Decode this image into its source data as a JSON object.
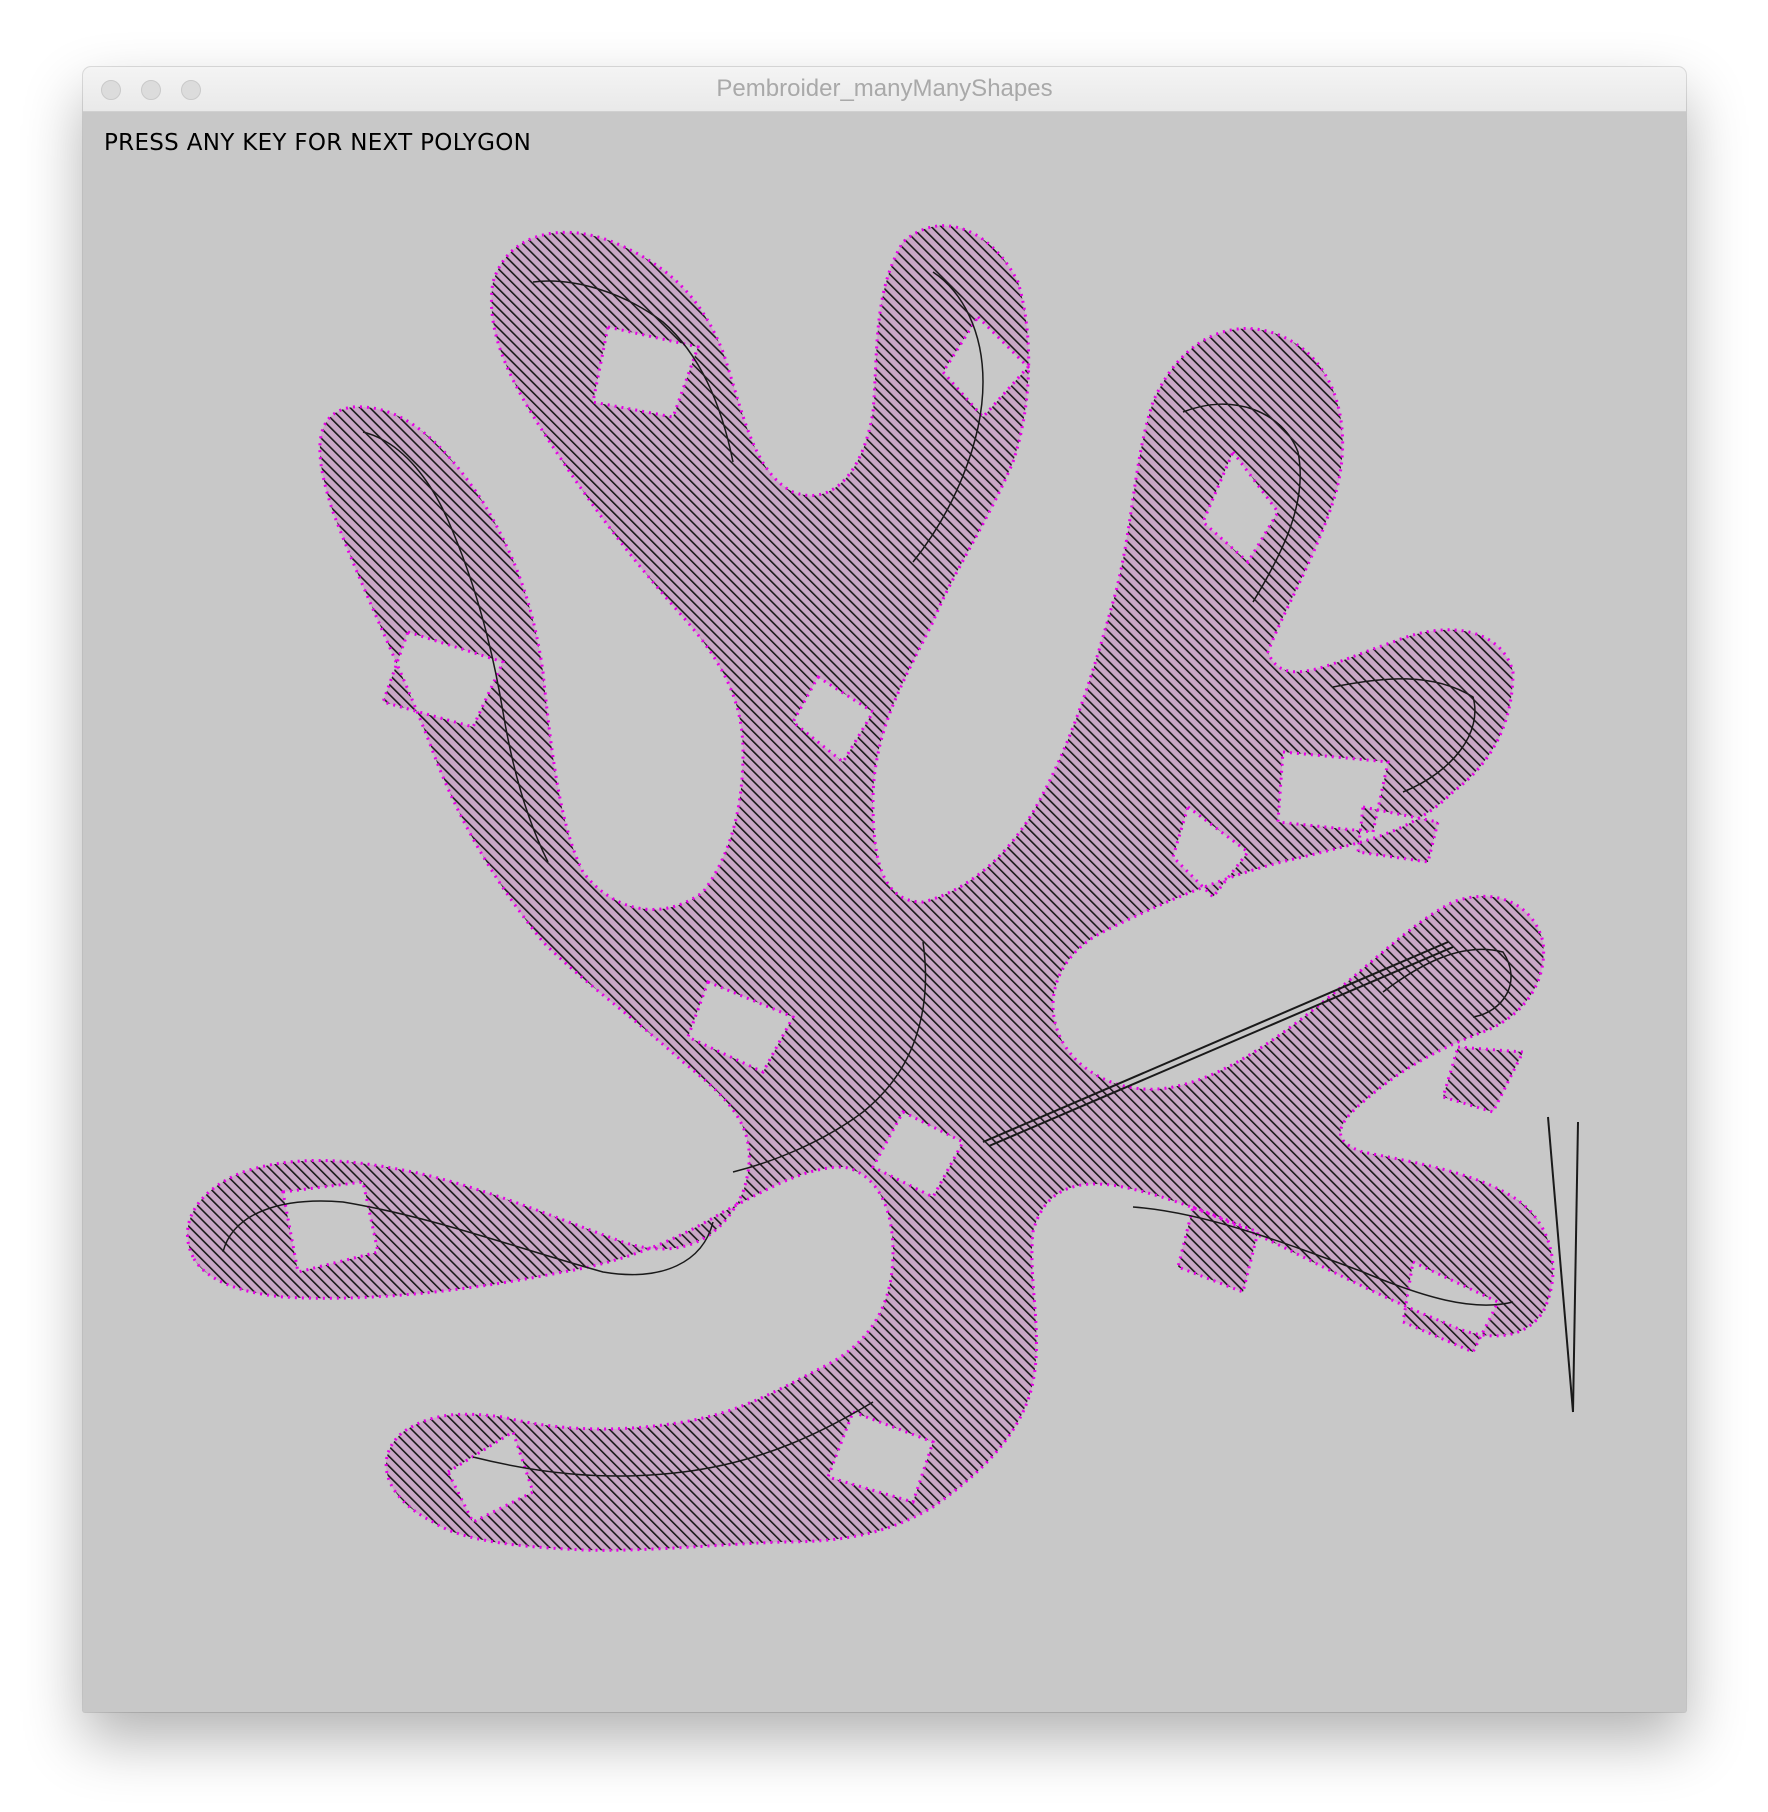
{
  "window": {
    "title": "Pembroider_manyManyShapes"
  },
  "canvas": {
    "prompt": "PRESS ANY KEY FOR NEXT POLYGON",
    "colors": {
      "background": "#c8c8c8",
      "fill": "#c9a8c6",
      "outline": "#e600e6",
      "hatch": "#1a1a1a"
    }
  }
}
